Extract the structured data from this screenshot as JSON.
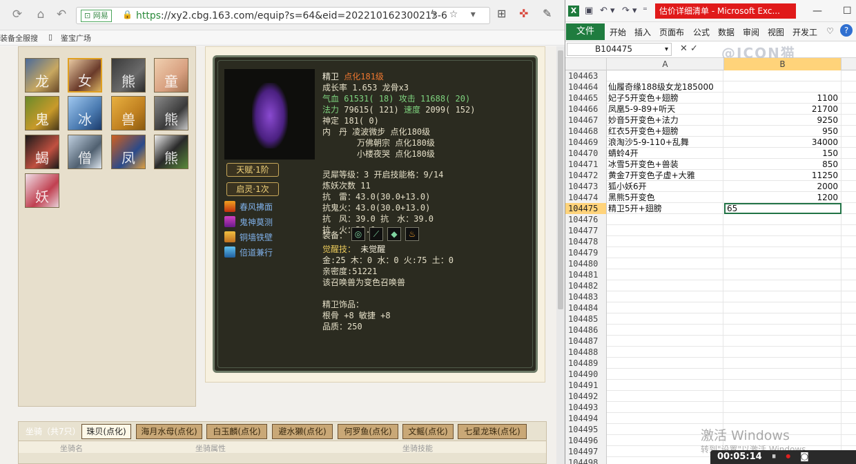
{
  "browser": {
    "url_site_label": "网易",
    "url_https": "https",
    "url_rest": "://xy2.cbg.163.com/equip?s=64&eid=202210162300213-6",
    "bookmarks": [
      "装备全服搜",
      "鉴宝广场"
    ],
    "pet_glyphs": [
      "龙",
      "女",
      "熊",
      "童",
      "鬼",
      "冰",
      "兽",
      "熊",
      "蝎",
      "僧",
      "凤",
      "熊",
      "妖"
    ],
    "detail": {
      "name": "精卫",
      "level": "点化181级",
      "growth": "成长率 1.653 龙骨x3",
      "hp_label": "气血",
      "hp": "61531( 18)",
      "atk_label": "攻击",
      "atk": "11688( 20)",
      "mp_label": "法力",
      "mp": "79615( 121)",
      "speed_label": "速度",
      "speed": "2099( 152)",
      "focus": "神定 181( 0)",
      "neidan_label": "内　丹",
      "neidan": [
        "凌波微步 点化180级",
        "万佛朝宗 点化180级",
        "小楼夜哭 点化180级"
      ],
      "talent": "天赋·1阶",
      "awaken": "启灵·1次",
      "skills": [
        "春风拂面",
        "鬼神莫测",
        "铜墙铁壁",
        "倍道兼行"
      ],
      "lingxi": "灵犀等级：3 开启技能格：9/14",
      "refine": "炼妖次数 11",
      "res1": "抗　雷：43.0(30.0+13.0)",
      "res2": "抗鬼火：43.0(30.0+13.0)",
      "res3": "抗　风：39.0 抗　水：39.0",
      "res4": "抗　火：39.0",
      "equip_label": "装备：",
      "awaken_skill_label": "觉醒技：",
      "awaken_skill": "未觉醒",
      "elements": "金:25 木：0 水：0 火:75 土：0",
      "intimacy": "亲密度:51221",
      "variant": "该召唤兽为变色召唤兽",
      "acc_title": "精卫饰品：",
      "acc_stats": "根骨 +8 敏捷 +8",
      "acc_quality": "品质：250"
    },
    "mount": {
      "title": "坐骑（共7只）",
      "tabs": [
        "珠贝(点化)",
        "海月水母(点化)",
        "白玉麟(点化)",
        "避水獭(点化)",
        "何罗鱼(点化)",
        "文鳐(点化)",
        "七星龙珠(点化)"
      ],
      "headers": [
        "坐骑名",
        "坐骑属性",
        "坐骑技能"
      ]
    }
  },
  "excel": {
    "doc_title": "估价详细清单 - Microsoft Exc...",
    "file_tab": "文件",
    "ribbon_tabs": [
      "开始",
      "插入",
      "页面布",
      "公式",
      "数据",
      "审阅",
      "视图",
      "开发工"
    ],
    "name_box": "B104475",
    "watermark": "@ICON猫",
    "columns": [
      "A",
      "B"
    ],
    "rows": [
      {
        "n": "104463",
        "a": "",
        "b": ""
      },
      {
        "n": "104464",
        "a": "仙履奇缘188级女龙185000",
        "b": ""
      },
      {
        "n": "104465",
        "a": "妃子5开变色+翅膀",
        "b": "1100"
      },
      {
        "n": "104466",
        "a": "凤凰5-9-89+听天",
        "b": "21700"
      },
      {
        "n": "104467",
        "a": "妙音5开变色+法力",
        "b": "9250"
      },
      {
        "n": "104468",
        "a": "红衣5开变色+翅膀",
        "b": "950"
      },
      {
        "n": "104469",
        "a": "浪淘沙5-9-110+乱舞",
        "b": "34000"
      },
      {
        "n": "104470",
        "a": "蜻蛉4开",
        "b": "150"
      },
      {
        "n": "104471",
        "a": "冰雪5开变色+兽装",
        "b": "850"
      },
      {
        "n": "104472",
        "a": "黄金7开变色子虚+大雅",
        "b": "11250"
      },
      {
        "n": "104473",
        "a": "狐小妖6开",
        "b": "2000"
      },
      {
        "n": "104474",
        "a": "黑熊5开变色",
        "b": "1200"
      },
      {
        "n": "104475",
        "a": "精卫5开+翅膀",
        "b": "65"
      },
      {
        "n": "104476",
        "a": "",
        "b": ""
      },
      {
        "n": "104477",
        "a": "",
        "b": ""
      },
      {
        "n": "104478",
        "a": "",
        "b": ""
      },
      {
        "n": "104479",
        "a": "",
        "b": ""
      },
      {
        "n": "104480",
        "a": "",
        "b": ""
      },
      {
        "n": "104481",
        "a": "",
        "b": ""
      },
      {
        "n": "104482",
        "a": "",
        "b": ""
      },
      {
        "n": "104483",
        "a": "",
        "b": ""
      },
      {
        "n": "104484",
        "a": "",
        "b": ""
      },
      {
        "n": "104485",
        "a": "",
        "b": ""
      },
      {
        "n": "104486",
        "a": "",
        "b": ""
      },
      {
        "n": "104487",
        "a": "",
        "b": ""
      },
      {
        "n": "104488",
        "a": "",
        "b": ""
      },
      {
        "n": "104489",
        "a": "",
        "b": ""
      },
      {
        "n": "104490",
        "a": "",
        "b": ""
      },
      {
        "n": "104491",
        "a": "",
        "b": ""
      },
      {
        "n": "104492",
        "a": "",
        "b": ""
      },
      {
        "n": "104493",
        "a": "",
        "b": ""
      },
      {
        "n": "104494",
        "a": "",
        "b": ""
      },
      {
        "n": "104495",
        "a": "",
        "b": ""
      },
      {
        "n": "104496",
        "a": "",
        "b": ""
      },
      {
        "n": "104497",
        "a": "",
        "b": ""
      },
      {
        "n": "104498",
        "a": "",
        "b": ""
      }
    ],
    "selected_row": "104475"
  },
  "overlay": {
    "activate_title": "激活 Windows",
    "activate_sub": "转到\"设置\"以激活 Windows。",
    "timer": "00:05:14"
  },
  "colors": {
    "excel_green": "#217346",
    "panel_dark": "#2b2b20",
    "accent_orange": "#f07830",
    "stat_green": "#7fd47f"
  }
}
